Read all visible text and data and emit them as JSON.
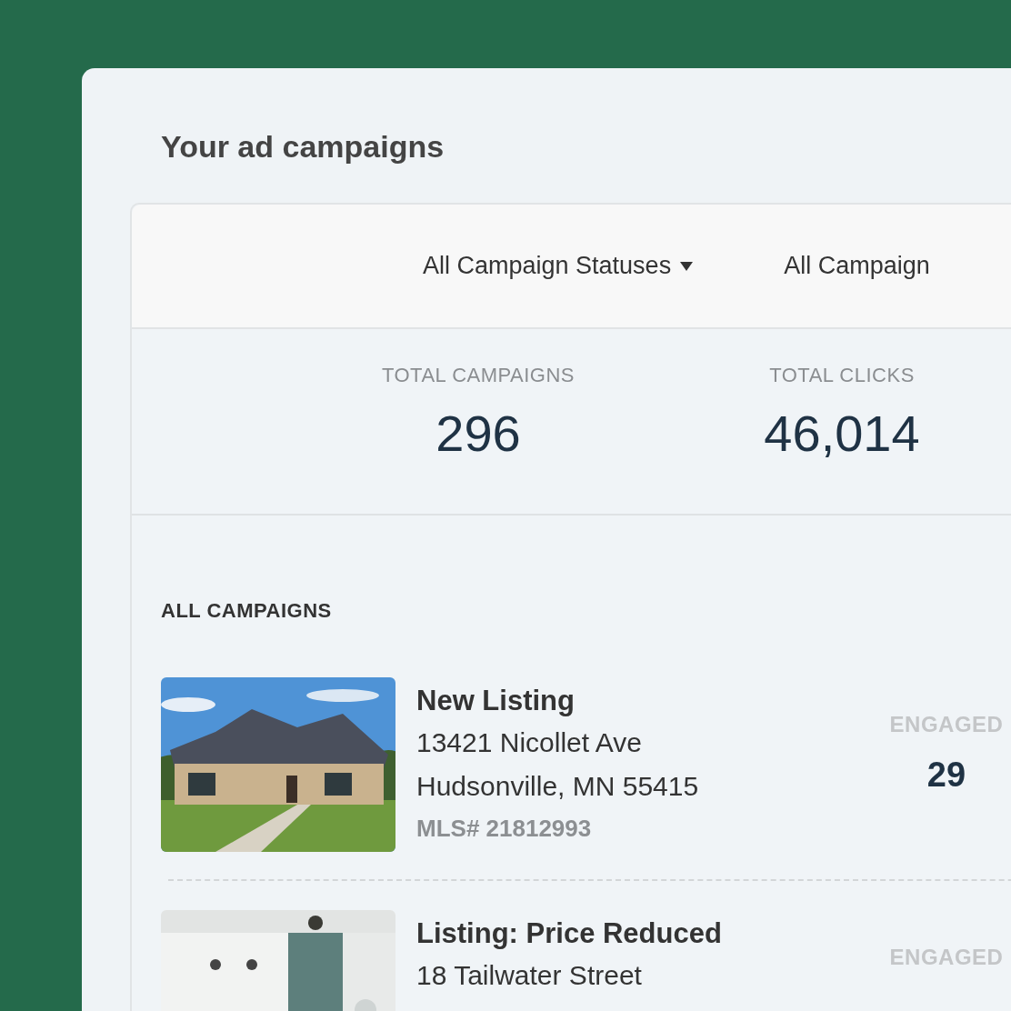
{
  "title": "Your ad campaigns",
  "filters": [
    {
      "label": "All Campaign Statuses",
      "caret": true
    },
    {
      "label": "All Campaign",
      "caret": false
    }
  ],
  "stats": [
    {
      "label": "TOTAL CAMPAIGNS",
      "value": "296"
    },
    {
      "label": "TOTAL CLICKS",
      "value": "46,014"
    }
  ],
  "list_heading": "ALL CAMPAIGNS",
  "campaigns": [
    {
      "title": "New Listing",
      "address": [
        "13421 Nicollet Ave",
        "Hudsonville, MN 55415"
      ],
      "mls": "MLS# 21812993",
      "engaged_label": "ENGAGED",
      "engaged": "29"
    },
    {
      "title": "Listing: Price Reduced",
      "address": [
        "18 Tailwater Street"
      ],
      "engaged_label": "ENGAGED"
    }
  ]
}
